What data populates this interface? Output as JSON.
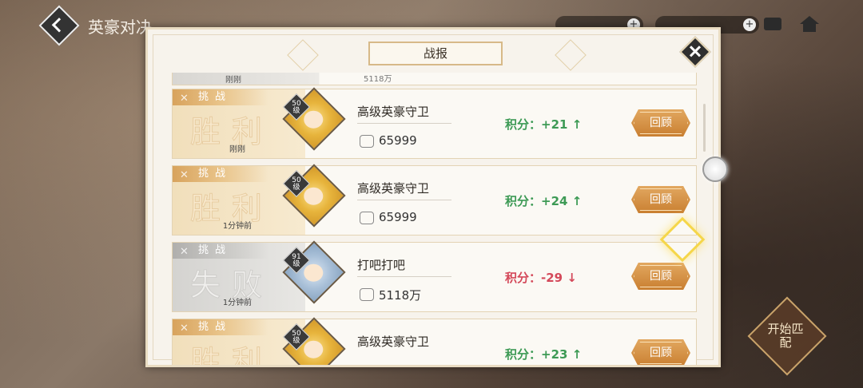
{
  "header": {
    "title": "英豪对决",
    "currency": [
      {
        "icon": "coin-icon",
        "value": ""
      },
      {
        "icon": "gem-icon",
        "value": ""
      }
    ]
  },
  "dialog": {
    "title": "战报",
    "prev_row": {
      "time": "刚刚",
      "power": "5118万"
    },
    "records": [
      {
        "result": "win",
        "tag": "挑战",
        "result_text": "胜利",
        "time": "刚刚",
        "level": "50",
        "level_unit": "级",
        "name": "高级英豪守卫",
        "power": "65999",
        "score": "积分：+21",
        "arrow": "↑",
        "review": "回顾"
      },
      {
        "result": "win",
        "tag": "挑战",
        "result_text": "胜利",
        "time": "1分钟前",
        "level": "50",
        "level_unit": "级",
        "name": "高级英豪守卫",
        "power": "65999",
        "score": "积分：+24",
        "arrow": "↑",
        "review": "回顾"
      },
      {
        "result": "loss",
        "tag": "挑战",
        "result_text": "失败",
        "time": "1分钟前",
        "level": "91",
        "level_unit": "级",
        "name": "打吧打吧",
        "power": "5118万",
        "score": "积分：-29",
        "arrow": "↓",
        "review": "回顾"
      },
      {
        "result": "win",
        "tag": "挑战",
        "result_text": "胜利",
        "time": "",
        "level": "50",
        "level_unit": "级",
        "name": "高级英豪守卫",
        "power": "",
        "score": "积分：+23",
        "arrow": "↑",
        "review": "回顾"
      }
    ]
  },
  "match_button": {
    "label": "开始匹配"
  },
  "colors": {
    "win": "#3d9a55",
    "loss": "#d4495a",
    "accent": "#c97f31"
  }
}
